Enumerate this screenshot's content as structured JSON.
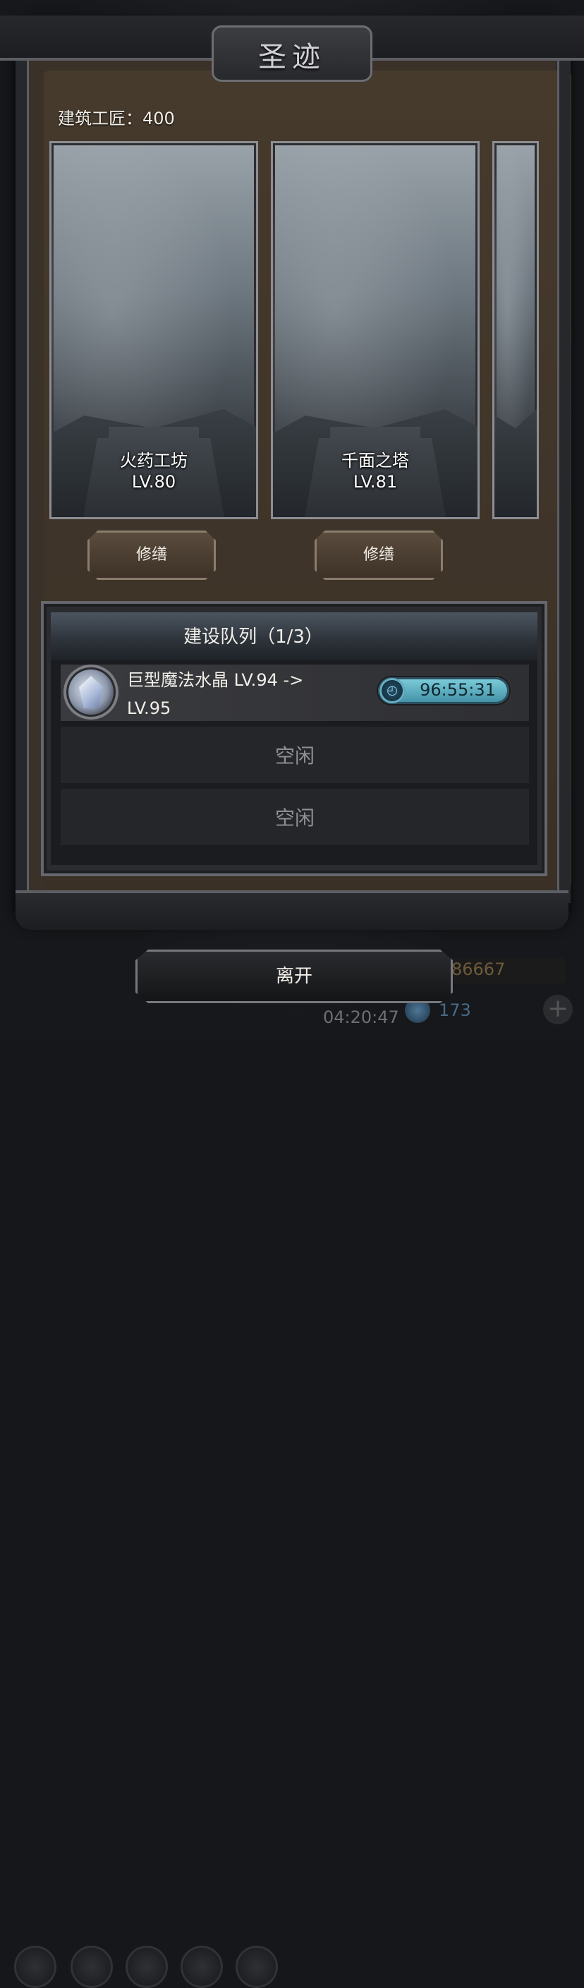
{
  "header": {
    "title": "圣迹"
  },
  "builders": {
    "label": "建筑工匠：400"
  },
  "buildings": [
    {
      "name": "火药工坊",
      "level": "LV.80",
      "repair_label": "修缮"
    },
    {
      "name": "千面之塔",
      "level": "LV.81",
      "repair_label": "修缮"
    }
  ],
  "queue": {
    "title": "建设队列（1/3）",
    "items": [
      {
        "name": "巨型魔法水晶 LV.94 -> LV.95",
        "timer": "96:55:31",
        "icon": "magic-crystal-icon"
      }
    ],
    "idle_slots": [
      "空闲",
      "空闲"
    ]
  },
  "leave_label": "离开",
  "background_hud": {
    "gold": "86667",
    "clock": "04:20:47",
    "gems": "173"
  },
  "colors": {
    "timer": "#5fb4c8",
    "panel": "#3a3128"
  }
}
